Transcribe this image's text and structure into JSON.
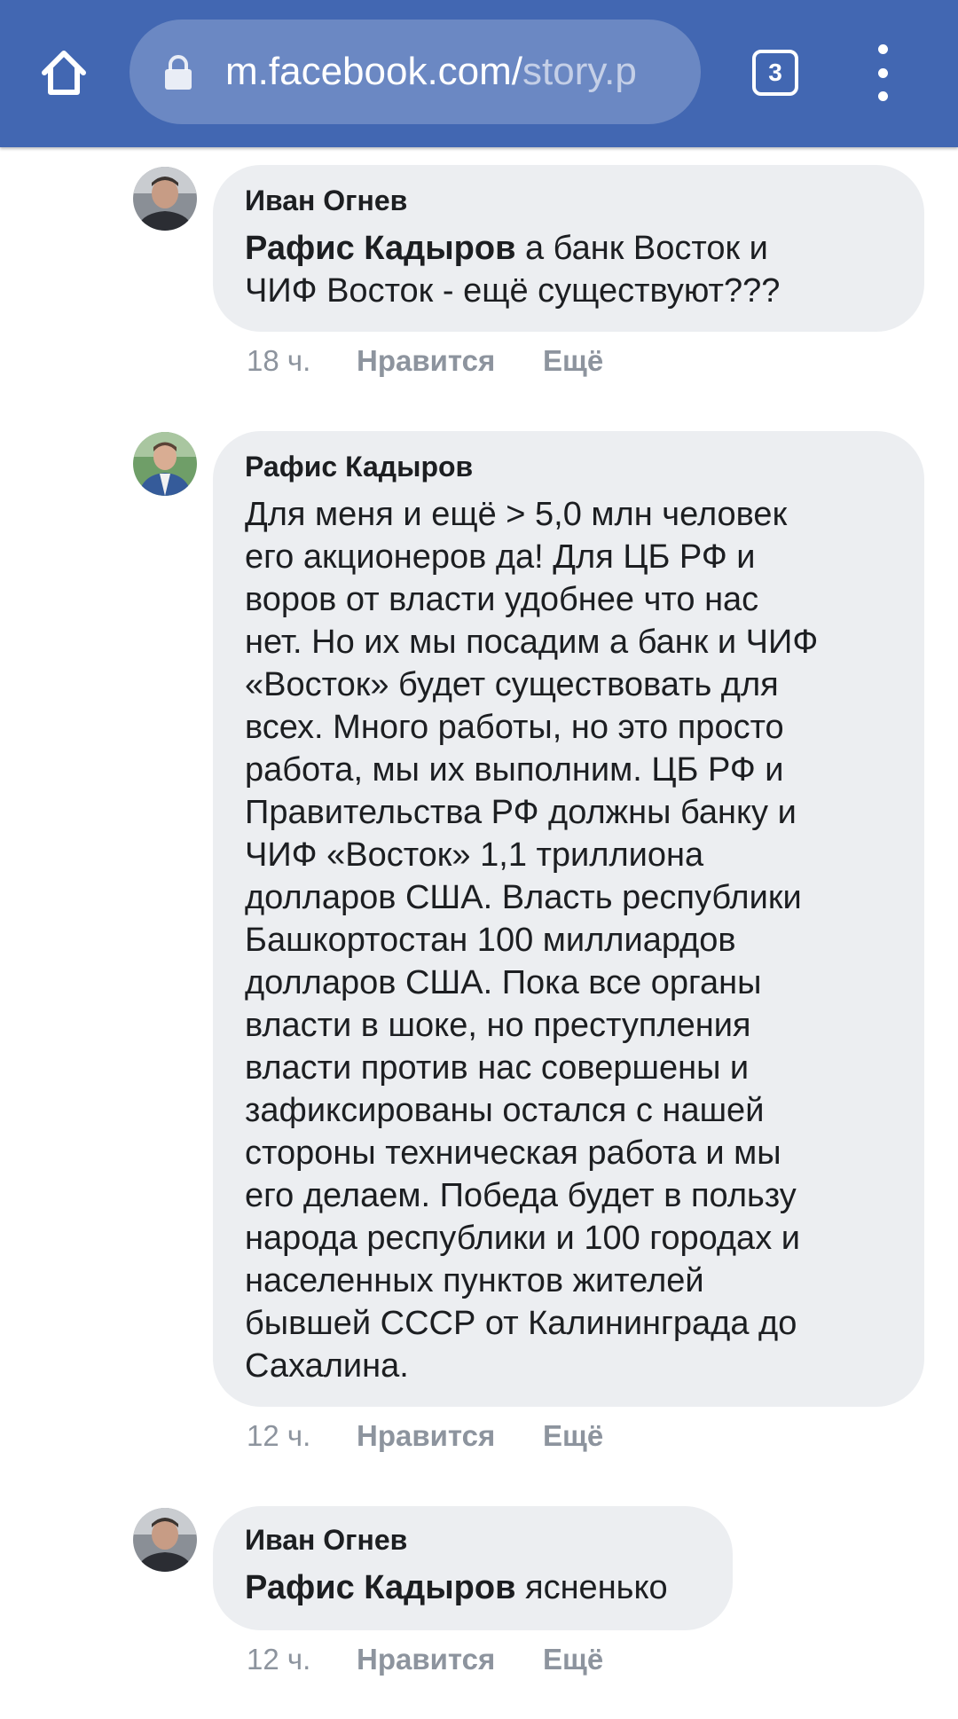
{
  "browser": {
    "url_host": "m.facebook.com/",
    "url_path": "story.p",
    "tab_count": "3"
  },
  "comments": [
    {
      "author": "Иван Огнев",
      "mention": "Рафис Кадыров",
      "text_lines": [
        " а банк Восток и",
        "ЧИФ Восток - ещё существуют???"
      ],
      "time": "18 ч.",
      "like_label": "Нравится",
      "more_label": "Ещё"
    },
    {
      "author": "Рафис Кадыров",
      "text_lines": [
        "Для меня и ещё > 5,0 млн человек",
        "его акционеров да! Для ЦБ РФ и",
        "воров от власти удобнее что нас",
        "нет. Но их мы посадим а банк и ЧИФ",
        "«Восток» будет существовать для",
        "всех. Много работы, но это просто",
        "работа, мы их выполним. ЦБ РФ и",
        "Правительства РФ должны банку и",
        "ЧИФ «Восток» 1,1 триллиона",
        "долларов США. Власть республики",
        "Башкортостан 100 миллиардов",
        "долларов США. Пока все органы",
        "власти в шоке, но преступления",
        "власти против нас совершены и",
        "зафиксированы остался с нашей",
        "стороны техническая работа и мы",
        "его делаем. Победа будет в пользу",
        "народа республики и 100 городах и",
        "населенных пунктов жителей",
        "бывшей СССР от Калининграда до",
        "Сахалина."
      ],
      "time": "12 ч.",
      "like_label": "Нравится",
      "more_label": "Ещё"
    },
    {
      "author": "Иван Огнев",
      "mention": "Рафис Кадыров",
      "text_lines": [
        " ясненько"
      ],
      "time": "12 ч.",
      "like_label": "Нравится",
      "more_label": "Ещё"
    }
  ]
}
